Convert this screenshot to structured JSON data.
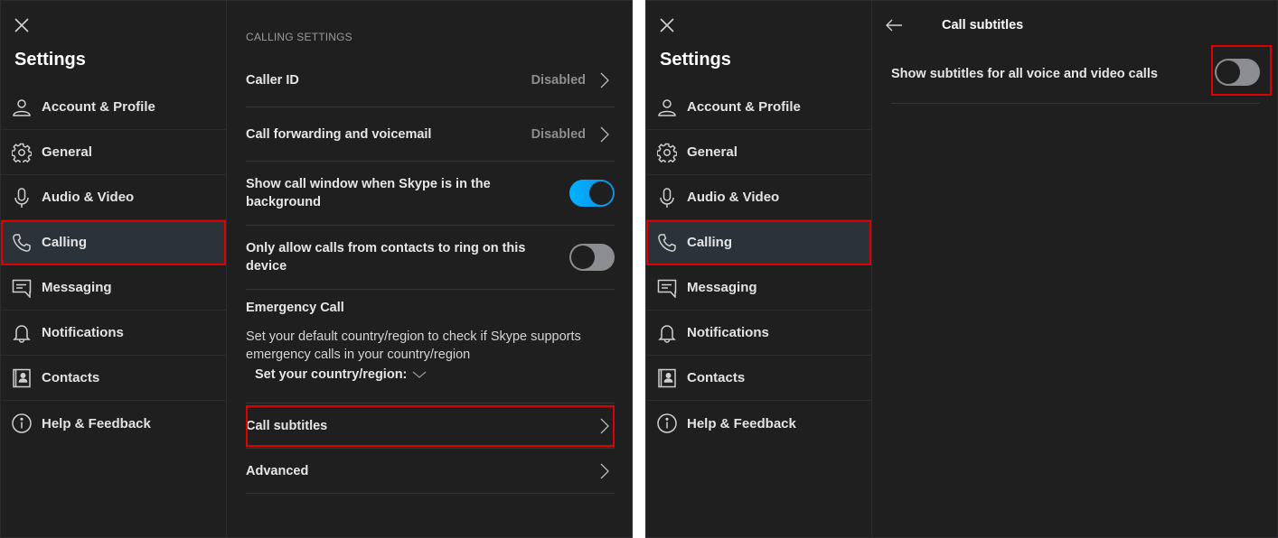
{
  "left_window": {
    "close_icon": "close-icon",
    "title": "Settings",
    "sidebar": {
      "items": [
        {
          "label": "Account & Profile",
          "icon": "person-icon",
          "active": false
        },
        {
          "label": "General",
          "icon": "gear-icon",
          "active": false
        },
        {
          "label": "Audio & Video",
          "icon": "microphone-icon",
          "active": false
        },
        {
          "label": "Calling",
          "icon": "phone-icon",
          "active": true
        },
        {
          "label": "Messaging",
          "icon": "message-icon",
          "active": false
        },
        {
          "label": "Notifications",
          "icon": "bell-icon",
          "active": false
        },
        {
          "label": "Contacts",
          "icon": "contacts-icon",
          "active": false
        },
        {
          "label": "Help & Feedback",
          "icon": "info-icon",
          "active": false
        }
      ]
    },
    "content": {
      "section_header": "CALLING SETTINGS",
      "caller_id": {
        "label": "Caller ID",
        "value": "Disabled"
      },
      "call_forwarding": {
        "label": "Call forwarding and voicemail",
        "value": "Disabled"
      },
      "show_call_window": {
        "label": "Show call window when Skype is in the background",
        "enabled": true
      },
      "only_contacts_ring": {
        "label": "Only allow calls from contacts to ring on this device",
        "enabled": false
      },
      "emergency": {
        "title": "Emergency Call",
        "description": "Set your default country/region to check if Skype supports emergency calls in your country/region",
        "select_label": "Set your country/region:"
      },
      "call_subtitles": {
        "label": "Call subtitles"
      },
      "advanced": {
        "label": "Advanced"
      }
    }
  },
  "right_window": {
    "title": "Settings",
    "sidebar": {
      "items": [
        {
          "label": "Account & Profile"
        },
        {
          "label": "General"
        },
        {
          "label": "Audio & Video"
        },
        {
          "label": "Calling"
        },
        {
          "label": "Messaging"
        },
        {
          "label": "Notifications"
        },
        {
          "label": "Contacts"
        },
        {
          "label": "Help & Feedback"
        }
      ]
    },
    "subpage": {
      "title": "Call subtitles",
      "show_subtitles": {
        "label": "Show subtitles for all voice and video calls",
        "enabled": false
      }
    }
  },
  "colors": {
    "background": "#1f1f1f",
    "active_item": "#2c323a",
    "toggle_on": "#00a8f0",
    "toggle_off": "#8b8d91",
    "highlight": "#e00000"
  }
}
